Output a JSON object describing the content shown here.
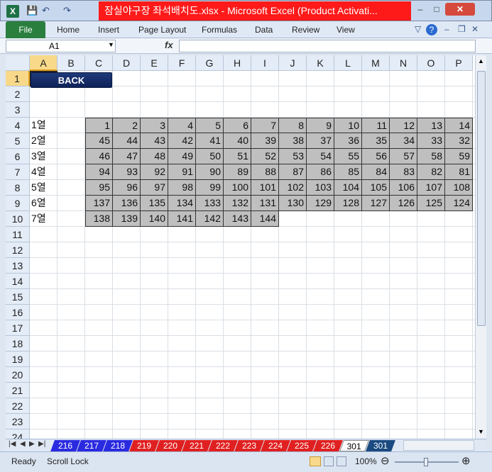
{
  "window": {
    "title": "잠실야구장 좌석배치도.xlsx - Microsoft Excel (Product Activati...",
    "app_icon": "X",
    "controls": {
      "minimize": "–",
      "maximize": "□",
      "close": "✕"
    }
  },
  "quick_access": {
    "save_icon": "floppy",
    "undo_icon": "↶",
    "redo_icon": "↷"
  },
  "ribbon": {
    "file": "File",
    "tabs": [
      "Home",
      "Insert",
      "Page Layout",
      "Formulas",
      "Data",
      "Review",
      "View"
    ]
  },
  "formula_bar": {
    "name_box": "A1",
    "fx": "fx",
    "value": ""
  },
  "columns": [
    "A",
    "B",
    "C",
    "D",
    "E",
    "F",
    "G",
    "H",
    "I",
    "J",
    "K",
    "L",
    "M",
    "N",
    "O",
    "P"
  ],
  "rows": [
    "1",
    "2",
    "3",
    "4",
    "5",
    "6",
    "7",
    "8",
    "9",
    "10",
    "11",
    "12",
    "13",
    "14",
    "15",
    "16",
    "17",
    "18",
    "19",
    "20",
    "21",
    "22",
    "23",
    "24"
  ],
  "back_button": "BACK",
  "row_labels": [
    "1열",
    "2열",
    "3열",
    "4열",
    "5열",
    "6열",
    "7열"
  ],
  "seats": [
    [
      "1",
      "2",
      "3",
      "4",
      "5",
      "6",
      "7",
      "8",
      "9",
      "10",
      "11",
      "12",
      "13",
      "14"
    ],
    [
      "45",
      "44",
      "43",
      "42",
      "41",
      "40",
      "39",
      "38",
      "37",
      "36",
      "35",
      "34",
      "33",
      "32"
    ],
    [
      "46",
      "47",
      "48",
      "49",
      "50",
      "51",
      "52",
      "53",
      "54",
      "55",
      "56",
      "57",
      "58",
      "59"
    ],
    [
      "94",
      "93",
      "92",
      "91",
      "90",
      "89",
      "88",
      "87",
      "86",
      "85",
      "84",
      "83",
      "82",
      "81"
    ],
    [
      "95",
      "96",
      "97",
      "98",
      "99",
      "100",
      "101",
      "102",
      "103",
      "104",
      "105",
      "106",
      "107",
      "108"
    ],
    [
      "137",
      "136",
      "135",
      "134",
      "133",
      "132",
      "131",
      "130",
      "129",
      "128",
      "127",
      "126",
      "125",
      "124"
    ],
    [
      "138",
      "139",
      "140",
      "141",
      "142",
      "143",
      "144"
    ]
  ],
  "sheet_tabs": [
    {
      "label": "216",
      "color": "#2a2ae0"
    },
    {
      "label": "217",
      "color": "#2a2ae0"
    },
    {
      "label": "218",
      "color": "#2a2ae0"
    },
    {
      "label": "219",
      "color": "#e02020"
    },
    {
      "label": "220",
      "color": "#e02020"
    },
    {
      "label": "221",
      "color": "#e02020"
    },
    {
      "label": "222",
      "color": "#e02020"
    },
    {
      "label": "223",
      "color": "#e02020"
    },
    {
      "label": "224",
      "color": "#e02020"
    },
    {
      "label": "225",
      "color": "#e02020"
    },
    {
      "label": "226",
      "color": "#e02020"
    },
    {
      "label": "301",
      "color": "#ffffff"
    },
    {
      "label": "301",
      "color": "#1a4a80"
    }
  ],
  "status": {
    "ready": "Ready",
    "scroll_lock": "Scroll Lock",
    "zoom": "100%"
  }
}
